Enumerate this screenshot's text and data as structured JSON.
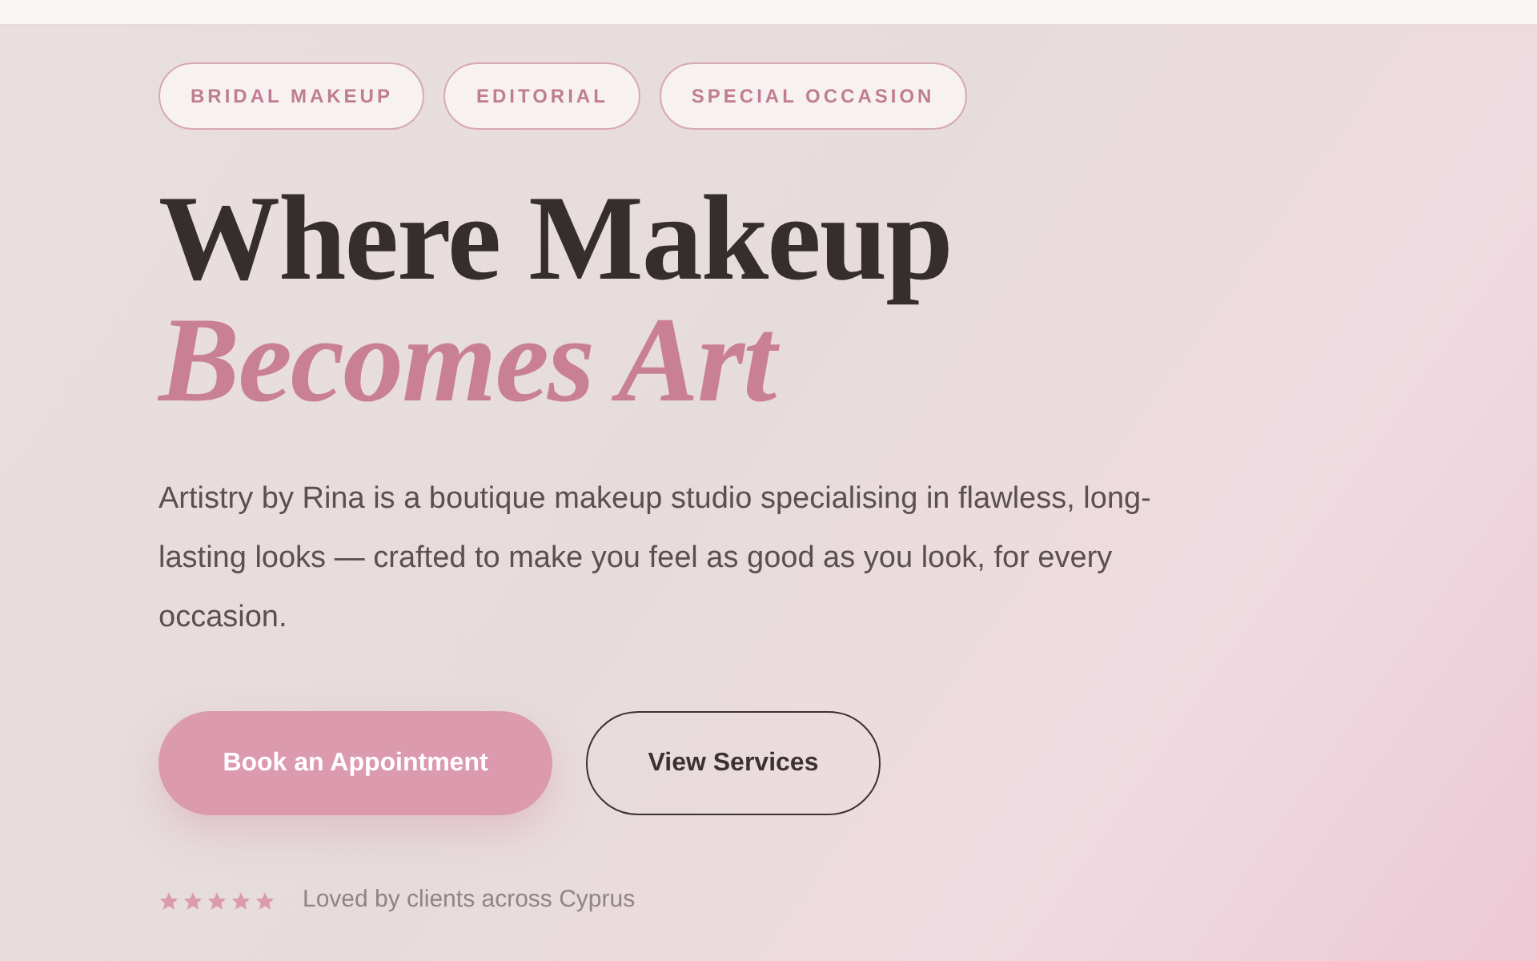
{
  "tags": [
    "BRIDAL MAKEUP",
    "EDITORIAL",
    "SPECIAL OCCASION"
  ],
  "heading": {
    "line_1": "Where Makeup",
    "line_2": "Becomes Art"
  },
  "description": "Artistry by Rina is a boutique makeup studio specialising in flawless, long-lasting looks — crafted to make you feel as good as you look, for every occasion.",
  "buttons": [
    {
      "label": "Book an Appointment",
      "kind": "primary"
    },
    {
      "label": "View Services",
      "kind": "outline"
    }
  ],
  "rating": {
    "stars": 5,
    "caption": "Loved by clients across Cyprus"
  }
}
